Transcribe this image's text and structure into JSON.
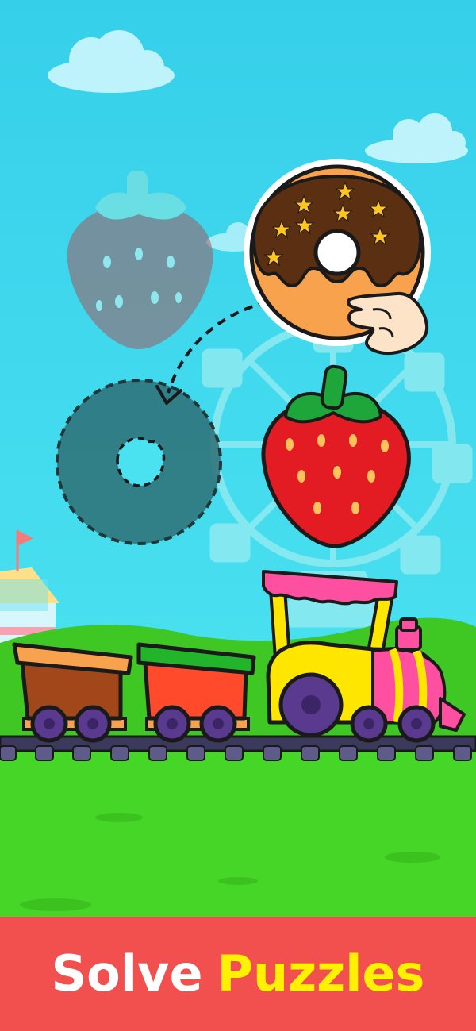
{
  "caption": {
    "word1": "Solve",
    "word2": "Puzzles"
  },
  "colors": {
    "sky": "#3fd7ee",
    "grass": "#45d627",
    "banner": "#f1504f",
    "caption_word1": "#ffffff",
    "caption_word2": "#fff200",
    "donut_dough": "#f9a24d",
    "donut_chocolate": "#5a2f12",
    "strawberry": "#e31b23",
    "leaves": "#1fa63b"
  },
  "pieces": {
    "draggable": "donut-piece",
    "placed": "strawberry-piece",
    "targets": [
      "strawberry-slot",
      "donut-slot"
    ]
  },
  "train": {
    "cars": [
      "engine",
      "green-car",
      "brown-car"
    ]
  }
}
